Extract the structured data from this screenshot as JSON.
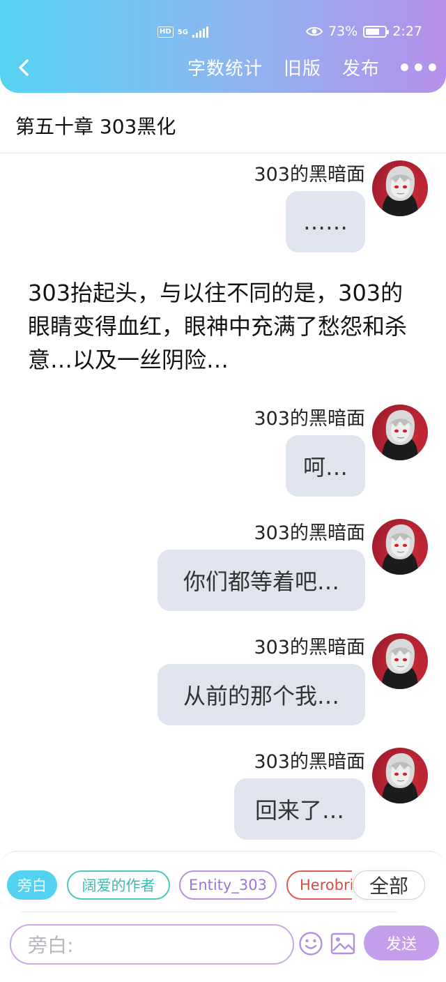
{
  "status_bar": {
    "hd_badge": "HD",
    "network": "5G",
    "battery_percent": "73%",
    "battery_level": 0.73,
    "time": "2:27"
  },
  "nav": {
    "word_count_label": "字数统计",
    "old_version_label": "旧版",
    "publish_label": "发布"
  },
  "chapter": {
    "title": "第五十章 303黑化"
  },
  "messages": [
    {
      "name": "303的黑暗面",
      "text": "……"
    },
    {
      "name": "303的黑暗面",
      "text": "呵…"
    },
    {
      "name": "303的黑暗面",
      "text": "你们都等着吧…"
    },
    {
      "name": "303的黑暗面",
      "text": "从前的那个我…"
    },
    {
      "name": "303的黑暗面",
      "text": "回来了…"
    }
  ],
  "narration": {
    "text": "303抬起头，与以往不同的是，303的眼睛变得血红，眼神中充满了愁怨和杀意…以及一丝阴险…"
  },
  "roles": [
    {
      "label": "旁白"
    },
    {
      "label": "阔爱的作者"
    },
    {
      "label": "Entity_303"
    },
    {
      "label": "Herobrine"
    }
  ],
  "all_roles_label": "全部",
  "composer": {
    "placeholder": "旁白:",
    "send_label": "发送"
  },
  "colors": {
    "header_gradient_start": "#56d3f3",
    "header_gradient_end": "#b690ea",
    "bubble_bg": "#dfe4ee",
    "send_button": "#c39eea",
    "active_chip": "#52d2f0"
  }
}
